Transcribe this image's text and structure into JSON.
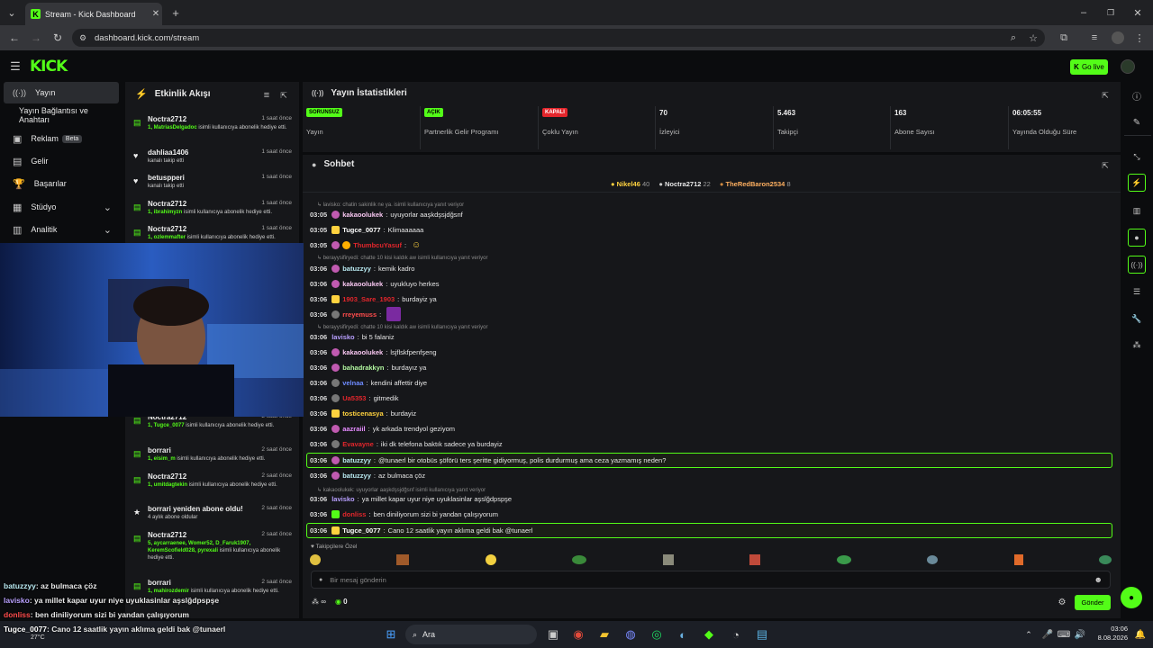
{
  "browser": {
    "tab_title": "Stream - Kick Dashboard",
    "url": "dashboard.kick.com/stream"
  },
  "header": {
    "logo": "KICK",
    "go_live": "Go live"
  },
  "sidebar": {
    "items": [
      {
        "label": "Yayın",
        "icon": "broadcast-icon"
      },
      {
        "label": "Yayın Bağlantısı ve Anahtarı"
      },
      {
        "label": "Reklam",
        "badge": "Beta",
        "icon": "ad-icon"
      },
      {
        "label": "Gelir",
        "icon": "revenue-icon"
      },
      {
        "label": "Başarılar",
        "icon": "trophy-icon"
      },
      {
        "label": "Stüdyo",
        "icon": "studio-icon"
      },
      {
        "label": "Analitik",
        "icon": "analytics-icon"
      }
    ]
  },
  "activity": {
    "title": "Etkinlik Akışı",
    "events": [
      {
        "name": "Noctra2712",
        "time": "1 saat önce",
        "sub_user": "1, MatriasDelgadoc",
        "sub_text": " isimli kullanıcıya abonelik hediye etti."
      },
      {
        "name": "dahliaa1406",
        "time": "1 saat önce",
        "sub_user": "",
        "sub_text": "kanalı takip etti"
      },
      {
        "name": "betuspperi",
        "time": "1 saat önce",
        "sub_user": "",
        "sub_text": "kanalı takip etti"
      },
      {
        "name": "Noctra2712",
        "time": "1 saat önce",
        "sub_user": "1, ibrahimyzn",
        "sub_text": " isimli kullanıcıya abonelik hediye etti."
      },
      {
        "name": "Noctra2712",
        "time": "1 saat önce",
        "sub_user": "1, ozlemmafter",
        "sub_text": " isimli kullanıcıya abonelik hediye etti."
      },
      {
        "name": "Noctra2712",
        "time": "2 saat önce",
        "sub_user": "1, Tugce_0077",
        "sub_text": " isimli kullanıcıya abonelik hediye etti."
      },
      {
        "name": "borrari",
        "time": "2 saat önce",
        "sub_user": "1, eisim_m",
        "sub_text": " isimli kullanıcıya abonelik hediye etti."
      },
      {
        "name": "Noctra2712",
        "time": "2 saat önce",
        "sub_user": "1, umitdagtekin",
        "sub_text": " isimli kullanıcıya abonelik hediye etti."
      },
      {
        "name": "borrari yeniden abone oldu!",
        "time": "2 saat önce",
        "sub_user": "",
        "sub_text": "4 aylık abone oldular"
      },
      {
        "name": "Noctra2712",
        "time": "2 saat önce",
        "sub_user": "5, aycarraenee, Womer52, D_Faruk1907, KeremScofield028, pyrexali",
        "sub_text": " isimli kullanıcıya abonelik hediye etti."
      },
      {
        "name": "borrari",
        "time": "2 saat önce",
        "sub_user": "1, mahirozdemir",
        "sub_text": " isimli kullanıcıya abonelik hediye etti."
      }
    ]
  },
  "stats": {
    "title": "Yayın İstatistikleri",
    "items": [
      {
        "badge": "SORUNSUZ",
        "badge_color": "#53fc18",
        "label": "Yayın"
      },
      {
        "badge": "AÇIK",
        "badge_color": "#53fc18",
        "label": "Partnerlik Gelir Programı"
      },
      {
        "badge": "KAPALI",
        "badge_color": "#e3262c",
        "label": "Çoklu Yayın"
      },
      {
        "value": "70",
        "label": "İzleyici"
      },
      {
        "value": "5.463",
        "label": "Takipçi"
      },
      {
        "value": "163",
        "label": "Abone Sayısı"
      },
      {
        "value": "06:05:55",
        "label": "Yayında Olduğu Süre"
      }
    ]
  },
  "chat": {
    "title": "Sohbet",
    "leaderboard": [
      {
        "name": "Nikel46",
        "count": "40"
      },
      {
        "name": "Noctra2712",
        "count": "22"
      },
      {
        "name": "TheRedBaron2534",
        "count": "8"
      }
    ],
    "replies": [
      "lavisko: chatin sakinlik ne ya. isimli kullanıcıya yanıt veriyor",
      "berayysifiryedi: chatte 10 kisi kaldık aw isimli kullanıcıya yanıt veriyor",
      "berayysifiryedi: chatte 10 kisi kaldık aw isimli kullanıcıya yanıt veriyor",
      "kakaoolukek: uyuyorlar aaşkdşsjdğsnf isimli kullanıcıya yanıt veriyor"
    ],
    "messages": [
      {
        "time": "03:05",
        "user": "kakaoolukek",
        "color": "#f7c6f0",
        "text": "uyuyorlar aaşkdşsjdğsnf"
      },
      {
        "time": "03:05",
        "user": "Tugce_0077",
        "color": "#ffffff",
        "text": "Klimaaaaaa"
      },
      {
        "time": "03:05",
        "user": "ThumbcuYasuf",
        "color": "#e3262c",
        "text": ""
      },
      {
        "time": "03:06",
        "user": "batuzzyy",
        "color": "#b8e9f0",
        "text": "kemik kadro"
      },
      {
        "time": "03:06",
        "user": "kakaoolukek",
        "color": "#f7c6f0",
        "text": "uyukluyo herkes"
      },
      {
        "time": "03:06",
        "user": "1903_Sare_1903",
        "color": "#e3262c",
        "text": "burdayiz ya"
      },
      {
        "time": "03:06",
        "user": "rreyemuss",
        "color": "#ff4c4c",
        "text": ""
      },
      {
        "time": "03:06",
        "user": "lavisko",
        "color": "#b9a0ff",
        "text": "bi 5 falaniz"
      },
      {
        "time": "03:06",
        "user": "kakaoolukek",
        "color": "#f7c6f0",
        "text": "lsjflskfpenfşeng"
      },
      {
        "time": "03:06",
        "user": "bahadrakkyn",
        "color": "#b2f7a0",
        "text": "burdayız ya"
      },
      {
        "time": "03:06",
        "user": "velnaa",
        "color": "#6e8bff",
        "text": "kendini affettir diye"
      },
      {
        "time": "03:06",
        "user": "Ua5353",
        "color": "#e3262c",
        "text": "gitmedik"
      },
      {
        "time": "03:06",
        "user": "tosticenasya",
        "color": "#ffd23f",
        "text": "burdayiz"
      },
      {
        "time": "03:06",
        "user": "aazraiil",
        "color": "#e58cff",
        "text": "yk arkada trendyol geziyom"
      },
      {
        "time": "03:06",
        "user": "Evavayne",
        "color": "#e3262c",
        "text": "iki dk telefona baktık sadece ya burdayiz"
      },
      {
        "time": "03:06",
        "user": "batuzzyy",
        "color": "#b8e9f0",
        "text": "@tunaerl bir otobüs şöförü ters şeritte gidiyormuş, polis durdurmuş ama ceza yazmamış neden?"
      },
      {
        "time": "03:06",
        "user": "batuzzyy",
        "color": "#b8e9f0",
        "text": "az bulmaca çöz"
      },
      {
        "time": "03:06",
        "user": "lavisko",
        "color": "#b9a0ff",
        "text": "ya millet kapar uyur niye uyuklasinlar aşslğdpspşe"
      },
      {
        "time": "03:06",
        "user": "donliss",
        "color": "#e3262c",
        "text": "ben diniliyorum sizi bi yandan çalışıyorum"
      },
      {
        "time": "03:06",
        "user": "Tugce_0077",
        "color": "#ffffff",
        "text": "Cano 12 saatlik yayın aklıma geldi bak @tunaerl"
      }
    ],
    "emote_label": "Takipçilere Özel",
    "input_placeholder": "Bir mesaj gönderin",
    "send": "Gönder",
    "points": "0",
    "slow_label": "∞"
  },
  "overlay": [
    {
      "user": "batuzzyy",
      "color": "#b8e9f0",
      "text": ": az bulmaca çöz"
    },
    {
      "user": "lavisko",
      "color": "#b9a0ff",
      "text": ": ya millet kapar uyur niye uyuklasinlar aşslğdpspşe"
    },
    {
      "user": "donliss",
      "color": "#ff4c4c",
      "text": ": ben diniliyorum sizi bi yandan çalışıyorum"
    },
    {
      "user": "Tugce_0077",
      "color": "#ffffff",
      "text": ": Cano 12 saatlik yayın aklıma geldi bak @tunaerl"
    }
  ],
  "taskbar": {
    "weather": "27°C",
    "search": "Ara",
    "time": "03:06",
    "date": "8.08.2026"
  }
}
